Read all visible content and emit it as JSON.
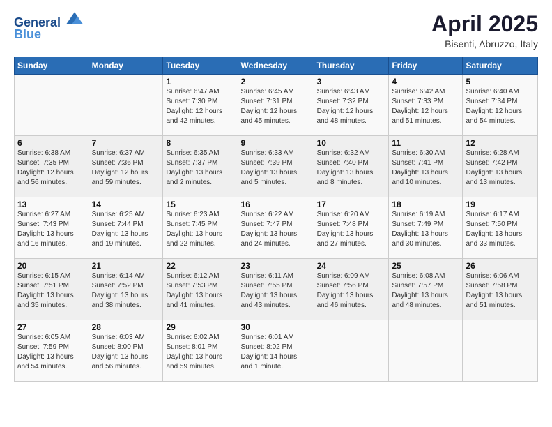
{
  "header": {
    "logo_line1": "General",
    "logo_line2": "Blue",
    "month_title": "April 2025",
    "subtitle": "Bisenti, Abruzzo, Italy"
  },
  "weekdays": [
    "Sunday",
    "Monday",
    "Tuesday",
    "Wednesday",
    "Thursday",
    "Friday",
    "Saturday"
  ],
  "weeks": [
    [
      {
        "day": "",
        "info": ""
      },
      {
        "day": "",
        "info": ""
      },
      {
        "day": "1",
        "info": "Sunrise: 6:47 AM\nSunset: 7:30 PM\nDaylight: 12 hours\nand 42 minutes."
      },
      {
        "day": "2",
        "info": "Sunrise: 6:45 AM\nSunset: 7:31 PM\nDaylight: 12 hours\nand 45 minutes."
      },
      {
        "day": "3",
        "info": "Sunrise: 6:43 AM\nSunset: 7:32 PM\nDaylight: 12 hours\nand 48 minutes."
      },
      {
        "day": "4",
        "info": "Sunrise: 6:42 AM\nSunset: 7:33 PM\nDaylight: 12 hours\nand 51 minutes."
      },
      {
        "day": "5",
        "info": "Sunrise: 6:40 AM\nSunset: 7:34 PM\nDaylight: 12 hours\nand 54 minutes."
      }
    ],
    [
      {
        "day": "6",
        "info": "Sunrise: 6:38 AM\nSunset: 7:35 PM\nDaylight: 12 hours\nand 56 minutes."
      },
      {
        "day": "7",
        "info": "Sunrise: 6:37 AM\nSunset: 7:36 PM\nDaylight: 12 hours\nand 59 minutes."
      },
      {
        "day": "8",
        "info": "Sunrise: 6:35 AM\nSunset: 7:37 PM\nDaylight: 13 hours\nand 2 minutes."
      },
      {
        "day": "9",
        "info": "Sunrise: 6:33 AM\nSunset: 7:39 PM\nDaylight: 13 hours\nand 5 minutes."
      },
      {
        "day": "10",
        "info": "Sunrise: 6:32 AM\nSunset: 7:40 PM\nDaylight: 13 hours\nand 8 minutes."
      },
      {
        "day": "11",
        "info": "Sunrise: 6:30 AM\nSunset: 7:41 PM\nDaylight: 13 hours\nand 10 minutes."
      },
      {
        "day": "12",
        "info": "Sunrise: 6:28 AM\nSunset: 7:42 PM\nDaylight: 13 hours\nand 13 minutes."
      }
    ],
    [
      {
        "day": "13",
        "info": "Sunrise: 6:27 AM\nSunset: 7:43 PM\nDaylight: 13 hours\nand 16 minutes."
      },
      {
        "day": "14",
        "info": "Sunrise: 6:25 AM\nSunset: 7:44 PM\nDaylight: 13 hours\nand 19 minutes."
      },
      {
        "day": "15",
        "info": "Sunrise: 6:23 AM\nSunset: 7:45 PM\nDaylight: 13 hours\nand 22 minutes."
      },
      {
        "day": "16",
        "info": "Sunrise: 6:22 AM\nSunset: 7:47 PM\nDaylight: 13 hours\nand 24 minutes."
      },
      {
        "day": "17",
        "info": "Sunrise: 6:20 AM\nSunset: 7:48 PM\nDaylight: 13 hours\nand 27 minutes."
      },
      {
        "day": "18",
        "info": "Sunrise: 6:19 AM\nSunset: 7:49 PM\nDaylight: 13 hours\nand 30 minutes."
      },
      {
        "day": "19",
        "info": "Sunrise: 6:17 AM\nSunset: 7:50 PM\nDaylight: 13 hours\nand 33 minutes."
      }
    ],
    [
      {
        "day": "20",
        "info": "Sunrise: 6:15 AM\nSunset: 7:51 PM\nDaylight: 13 hours\nand 35 minutes."
      },
      {
        "day": "21",
        "info": "Sunrise: 6:14 AM\nSunset: 7:52 PM\nDaylight: 13 hours\nand 38 minutes."
      },
      {
        "day": "22",
        "info": "Sunrise: 6:12 AM\nSunset: 7:53 PM\nDaylight: 13 hours\nand 41 minutes."
      },
      {
        "day": "23",
        "info": "Sunrise: 6:11 AM\nSunset: 7:55 PM\nDaylight: 13 hours\nand 43 minutes."
      },
      {
        "day": "24",
        "info": "Sunrise: 6:09 AM\nSunset: 7:56 PM\nDaylight: 13 hours\nand 46 minutes."
      },
      {
        "day": "25",
        "info": "Sunrise: 6:08 AM\nSunset: 7:57 PM\nDaylight: 13 hours\nand 48 minutes."
      },
      {
        "day": "26",
        "info": "Sunrise: 6:06 AM\nSunset: 7:58 PM\nDaylight: 13 hours\nand 51 minutes."
      }
    ],
    [
      {
        "day": "27",
        "info": "Sunrise: 6:05 AM\nSunset: 7:59 PM\nDaylight: 13 hours\nand 54 minutes."
      },
      {
        "day": "28",
        "info": "Sunrise: 6:03 AM\nSunset: 8:00 PM\nDaylight: 13 hours\nand 56 minutes."
      },
      {
        "day": "29",
        "info": "Sunrise: 6:02 AM\nSunset: 8:01 PM\nDaylight: 13 hours\nand 59 minutes."
      },
      {
        "day": "30",
        "info": "Sunrise: 6:01 AM\nSunset: 8:02 PM\nDaylight: 14 hours\nand 1 minute."
      },
      {
        "day": "",
        "info": ""
      },
      {
        "day": "",
        "info": ""
      },
      {
        "day": "",
        "info": ""
      }
    ]
  ]
}
